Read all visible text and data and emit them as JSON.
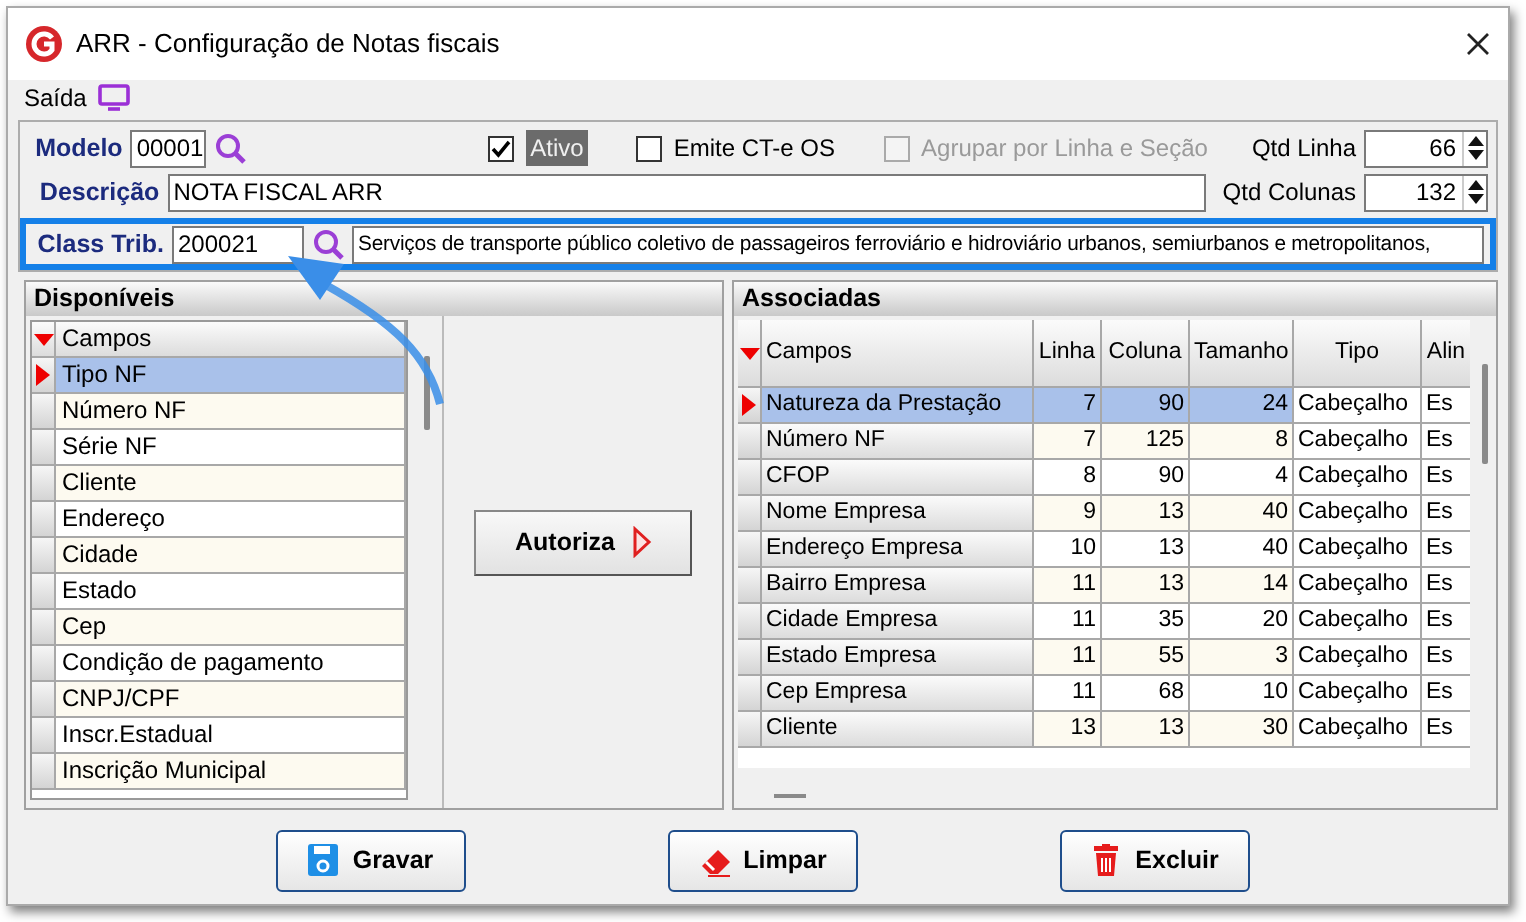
{
  "window": {
    "title": "ARR - Configuração de Notas fiscais"
  },
  "menu": [
    {
      "label": "Saída"
    }
  ],
  "fields": {
    "modelo": {
      "label": "Modelo",
      "value": "00001"
    },
    "descricao": {
      "label": "Descrição",
      "value": "NOTA FISCAL ARR"
    },
    "class_trib": {
      "label": "Class Trib.",
      "code": "200021",
      "description": "Serviços de transporte público coletivo de passageiros ferroviário e hidroviário urbanos, semiurbanos e metropolitanos,",
      "highlighted": true
    }
  },
  "checkboxes": [
    {
      "label": "Ativo",
      "checked": true,
      "disabled": false,
      "focused": true
    },
    {
      "label": "Emite CT-e OS",
      "checked": false,
      "disabled": false,
      "focused": false
    },
    {
      "label": "Agrupar por Linha e Seção",
      "checked": false,
      "disabled": true,
      "focused": false
    }
  ],
  "spinners": [
    {
      "label": "Qtd Linha",
      "value": "66"
    },
    {
      "label": "Qtd Colunas",
      "value": "132"
    }
  ],
  "disponiveis": {
    "title": "Disponíveis",
    "header": "Campos",
    "items": [
      {
        "label": "Tipo NF",
        "selected": true
      },
      {
        "label": "Número NF",
        "selected": false
      },
      {
        "label": "Série NF",
        "selected": false
      },
      {
        "label": "Cliente",
        "selected": false
      },
      {
        "label": "Endereço",
        "selected": false
      },
      {
        "label": "Cidade",
        "selected": false
      },
      {
        "label": "Estado",
        "selected": false
      },
      {
        "label": "Cep",
        "selected": false
      },
      {
        "label": "Condição de pagamento",
        "selected": false
      },
      {
        "label": "CNPJ/CPF",
        "selected": false
      },
      {
        "label": "Inscr.Estadual",
        "selected": false
      },
      {
        "label": "Inscrição Municipal",
        "selected": false
      }
    ]
  },
  "autoriza_button": {
    "label": "Autoriza"
  },
  "associadas": {
    "title": "Associadas",
    "columns": [
      "Campos",
      "Linha",
      "Coluna",
      "Tamanho",
      "Tipo",
      "Alin"
    ],
    "rows": [
      {
        "cells": [
          "Natureza da Prestação",
          "7",
          "90",
          "24",
          "Cabeçalho",
          "Es"
        ],
        "selected": true
      },
      {
        "cells": [
          "Número NF",
          "7",
          "125",
          "8",
          "Cabeçalho",
          "Es"
        ],
        "selected": false
      },
      {
        "cells": [
          "CFOP",
          "8",
          "90",
          "4",
          "Cabeçalho",
          "Es"
        ],
        "selected": false
      },
      {
        "cells": [
          "Nome Empresa",
          "9",
          "13",
          "40",
          "Cabeçalho",
          "Es"
        ],
        "selected": false
      },
      {
        "cells": [
          "Endereço Empresa",
          "10",
          "13",
          "40",
          "Cabeçalho",
          "Es"
        ],
        "selected": false
      },
      {
        "cells": [
          "Bairro Empresa",
          "11",
          "13",
          "14",
          "Cabeçalho",
          "Es"
        ],
        "selected": false
      },
      {
        "cells": [
          "Cidade Empresa",
          "11",
          "35",
          "20",
          "Cabeçalho",
          "Es"
        ],
        "selected": false
      },
      {
        "cells": [
          "Estado Empresa",
          "11",
          "55",
          "3",
          "Cabeçalho",
          "Es"
        ],
        "selected": false
      },
      {
        "cells": [
          "Cep Empresa",
          "11",
          "68",
          "10",
          "Cabeçalho",
          "Es"
        ],
        "selected": false
      },
      {
        "cells": [
          "Cliente",
          "13",
          "13",
          "30",
          "Cabeçalho",
          "Es"
        ],
        "selected": false
      }
    ]
  },
  "buttons": [
    {
      "kind": "save",
      "label": "Gravar"
    },
    {
      "kind": "clear",
      "label": "Limpar"
    },
    {
      "kind": "delete",
      "label": "Excluir"
    }
  ]
}
